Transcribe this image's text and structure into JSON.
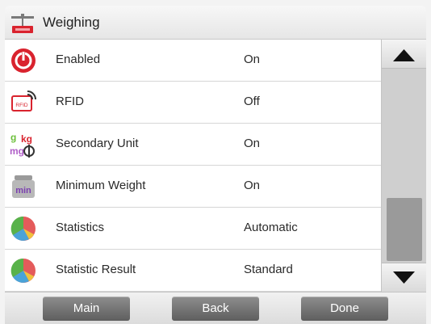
{
  "header": {
    "title": "Weighing",
    "icon": "balance-icon"
  },
  "rows": [
    {
      "label": "Enabled",
      "value": "On",
      "icon": "power-icon"
    },
    {
      "label": "RFID",
      "value": "Off",
      "icon": "rfid-icon"
    },
    {
      "label": "Secondary Unit",
      "value": "On",
      "icon": "units-icon",
      "icon_text": [
        "g",
        "kg",
        "mg"
      ]
    },
    {
      "label": "Minimum Weight",
      "value": "On",
      "icon": "min-weight-icon",
      "icon_text": "min"
    },
    {
      "label": "Statistics",
      "value": "Automatic",
      "icon": "statistics-icon"
    },
    {
      "label": "Statistic Result",
      "value": "Standard",
      "icon": "statistic-result-icon"
    }
  ],
  "scrollbar": {
    "up_icon": "triangle-up-icon",
    "down_icon": "triangle-down-icon"
  },
  "footer": {
    "main_label": "Main",
    "back_label": "Back",
    "done_label": "Done"
  },
  "colors": {
    "accent_red": "#d9232e",
    "header_bg": "#e9e9e9",
    "button_gray": "#6e6e6e"
  }
}
